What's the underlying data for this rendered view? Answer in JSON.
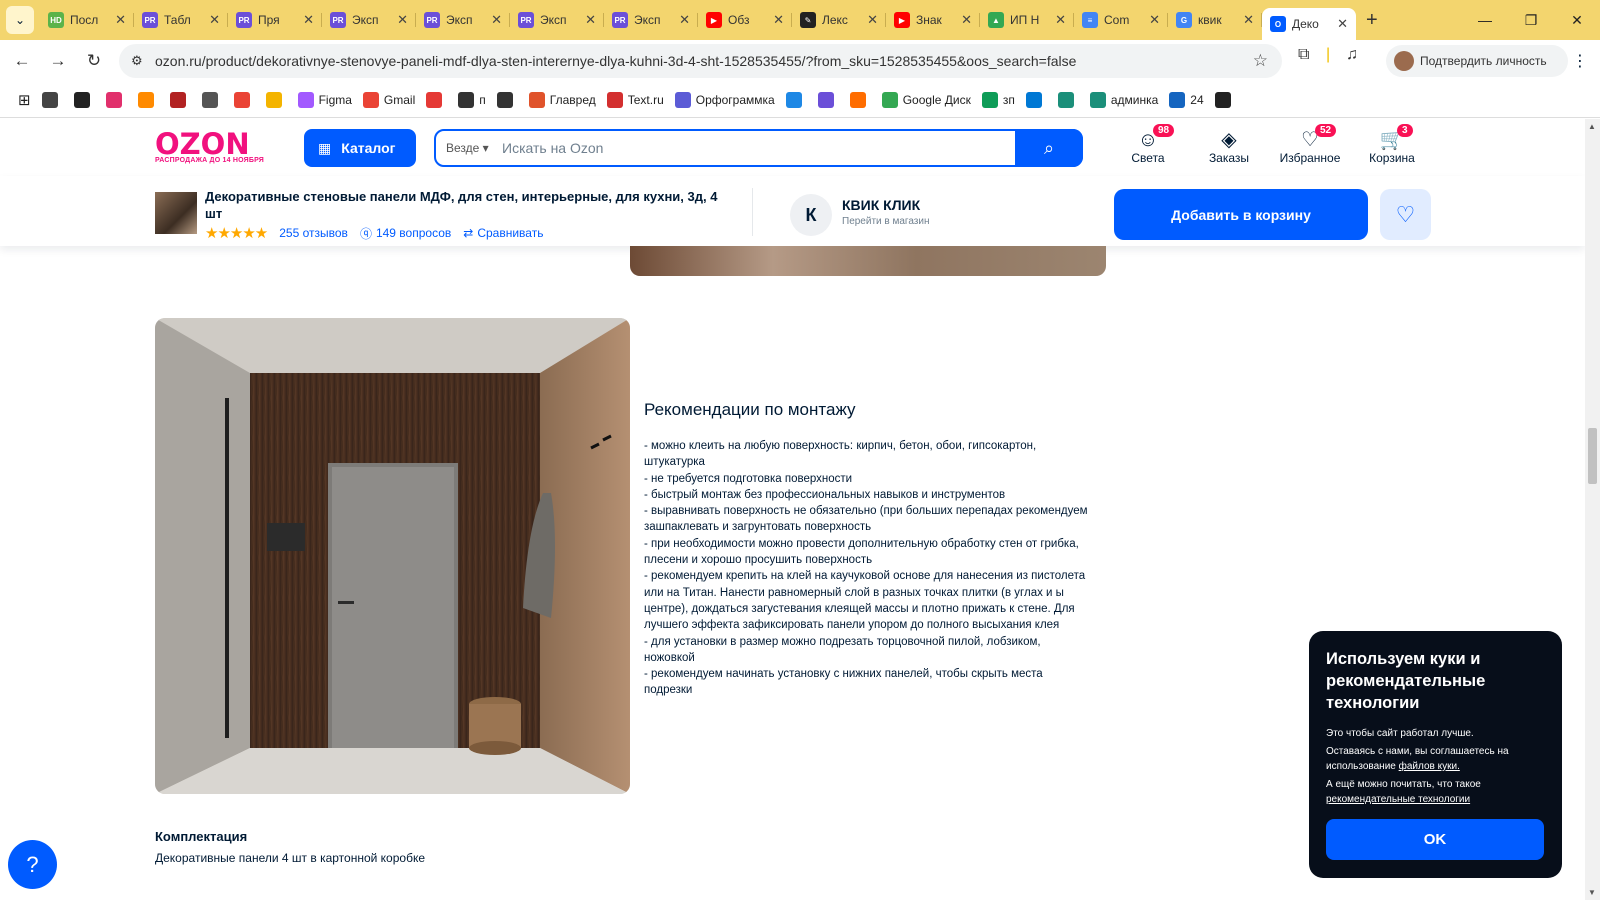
{
  "browser": {
    "tabs": [
      {
        "label": "Посл",
        "color": "#5bb34a",
        "fav": "HD"
      },
      {
        "label": "Табл",
        "color": "#6b4fd8",
        "fav": "PR"
      },
      {
        "label": "Пря",
        "color": "#6b4fd8",
        "fav": "PR"
      },
      {
        "label": "Эксп",
        "color": "#6b4fd8",
        "fav": "PR"
      },
      {
        "label": "Эксп",
        "color": "#6b4fd8",
        "fav": "PR"
      },
      {
        "label": "Эксп",
        "color": "#6b4fd8",
        "fav": "PR"
      },
      {
        "label": "Эксп",
        "color": "#6b4fd8",
        "fav": "PR"
      },
      {
        "label": "Обз",
        "color": "#ff0000",
        "fav": "▶"
      },
      {
        "label": "Лекс",
        "color": "#222222",
        "fav": "✎"
      },
      {
        "label": "Знак",
        "color": "#ff0000",
        "fav": "▶"
      },
      {
        "label": "ИП Н",
        "color": "#34a853",
        "fav": "▲"
      },
      {
        "label": "Com",
        "color": "#4285f4",
        "fav": "≡"
      },
      {
        "label": "квик",
        "color": "#4285f4",
        "fav": "G"
      },
      {
        "label": "Деко",
        "color": "#005bff",
        "fav": "O"
      }
    ],
    "url": "ozon.ru/product/dekorativnye-stenovye-paneli-mdf-dlya-sten-interernye-dlya-kuhni-3d-4-sht-1528535455/?from_sku=1528535455&oos_search=false",
    "verify_label": "Подтвердить личность",
    "bookmarks": [
      {
        "label": "",
        "color": "#444444"
      },
      {
        "label": "",
        "color": "#222222"
      },
      {
        "label": "",
        "color": "#e1306c"
      },
      {
        "label": "",
        "color": "#ff8a00"
      },
      {
        "label": "",
        "color": "#b22222"
      },
      {
        "label": "",
        "color": "#555555"
      },
      {
        "label": "",
        "color": "#ea4335"
      },
      {
        "label": "",
        "color": "#f4b400"
      },
      {
        "label": "Figma",
        "color": "#a259ff"
      },
      {
        "label": "Gmail",
        "color": "#ea4335"
      },
      {
        "label": "",
        "color": "#e53935"
      },
      {
        "label": "п",
        "color": "#333333"
      },
      {
        "label": "",
        "color": "#333333"
      },
      {
        "label": "Главред",
        "color": "#e0532b"
      },
      {
        "label": "Text.ru",
        "color": "#d32f2f"
      },
      {
        "label": "Орфограммка",
        "color": "#5b5bd6"
      },
      {
        "label": "",
        "color": "#1e88e5"
      },
      {
        "label": "",
        "color": "#6b4fd8"
      },
      {
        "label": "",
        "color": "#ff6d00"
      },
      {
        "label": "Google Диск",
        "color": "#34a853"
      },
      {
        "label": "зп",
        "color": "#0f9d58"
      },
      {
        "label": "",
        "color": "#0078d4"
      },
      {
        "label": "",
        "color": "#1b8f7a"
      },
      {
        "label": "админка",
        "color": "#1b8f7a"
      },
      {
        "label": "24",
        "color": "#1565c0"
      },
      {
        "label": "",
        "color": "#222222"
      }
    ]
  },
  "header": {
    "logo_word": "OZON",
    "logo_sub": "РАСПРОДАЖА ДО 14 НОЯБРЯ",
    "catalog_label": "Каталог",
    "search_scope": "Везде",
    "search_placeholder": "Искать на Ozon",
    "icons": [
      {
        "label": "Света",
        "badge": "98"
      },
      {
        "label": "Заказы",
        "badge": ""
      },
      {
        "label": "Избранное",
        "badge": "52"
      },
      {
        "label": "Корзина",
        "badge": "3"
      }
    ]
  },
  "product_bar": {
    "title": "Декоративные стеновые панели МДФ, для стен, интерьерные, для кухни, 3д, 4 шт",
    "rating_stars": 5,
    "reviews": "255 отзывов",
    "questions": "149 вопросов",
    "compare": "Сравнивать",
    "seller_initial": "К",
    "seller_name": "КВИК КЛИК",
    "seller_link": "Перейти в магазин",
    "add_to_cart": "Добавить в корзину"
  },
  "content": {
    "section_title": "Рекомендации по монтажу",
    "items": [
      "- можно клеить на любую поверхность: кирпич, бетон, обои, гипсокартон, штукатурка",
      "- не требуется подготовка поверхности",
      "- быстрый монтаж без профессиональных навыков и инструментов",
      "- выравнивать поверхность не обязательно (при больших перепадах рекомендуем зашпаклевать и загрунтовать поверхность",
      "- при необходимости можно провести дополнительную обработку стен от грибка, плесени и хорошо просушить поверхность",
      "- рекомендуем крепить на клей на каучуковой основе для нанесения из пистолета или на Титан. Нанести равномерный слой в разных точках плитки (в углах и ы центре), дождаться загустевания клеящей массы и плотно прижать к стене. Для лучшего эффекта зафиксировать панели упором до полного высыхания клея",
      "- для установки в размер можно подрезать торцовочной пилой, лобзиком, ножовкой",
      "- рекомендуем начинать установку с нижних панелей, чтобы скрыть места подрезки"
    ],
    "kit_title": "Комплектация",
    "kit_text": "Декоративные панели 4 шт в картонной коробке"
  },
  "cookie": {
    "title": "Используем куки и рекомендательные технологии",
    "line1": "Это чтобы сайт работал лучше.",
    "line2_pre": "Оставаясь с нами, вы соглашаетесь на использование ",
    "line2_link": "файлов куки.",
    "line3_pre": "А ещё можно почитать, что такое ",
    "line3_link": "рекомендательные технологии",
    "ok": "OK"
  },
  "colors": {
    "ozon_blue": "#005bff",
    "ozon_pink": "#f1117e",
    "badge": "#f91155",
    "chrome_tabbar": "#f3d56e"
  }
}
